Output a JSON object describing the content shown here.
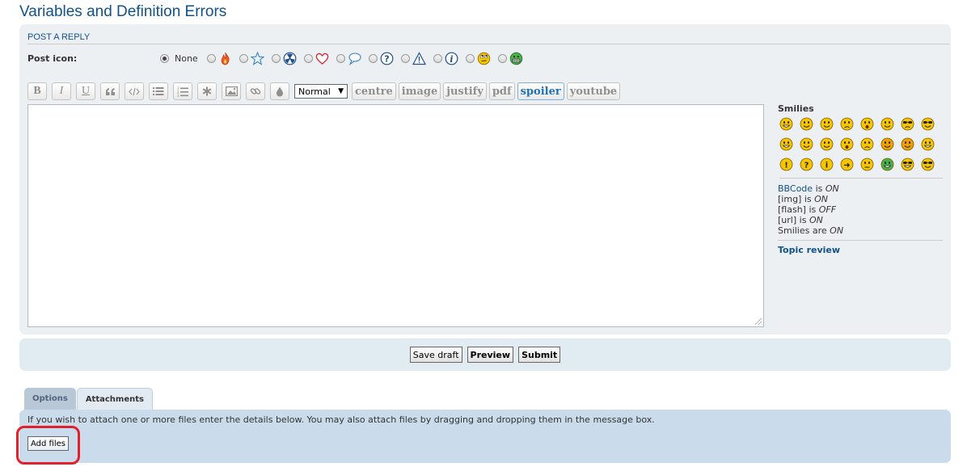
{
  "page": {
    "title": "Variables and Definition Errors"
  },
  "reply": {
    "heading": "POST A REPLY",
    "post_icon_label": "Post icon:",
    "none_label": "None",
    "icons": [
      "fire-icon",
      "star-icon",
      "radioactive-icon",
      "heart-icon",
      "speech-bubble-icon",
      "question-icon",
      "warning-icon",
      "info-icon",
      "rolling-eyes-icon",
      "grin-icon"
    ]
  },
  "toolbar": {
    "bold": "B",
    "italic": "I",
    "underline": "U",
    "font_size_value": "Normal",
    "words": [
      "centre",
      "image",
      "justify",
      "pdf",
      "spoiler",
      "youtube"
    ],
    "active_word": "spoiler"
  },
  "side": {
    "smilies_title": "Smilies",
    "bbcode_prefix": "BBCode",
    "bbcode_state": "ON",
    "img_label": "[img]",
    "img_state": "ON",
    "flash_label": "[flash]",
    "flash_state": "OFF",
    "url_label": "[url]",
    "url_state": "ON",
    "smilies_label": "Smilies are",
    "smilies_state": "ON",
    "is_word": "is",
    "topic_review": "Topic review"
  },
  "submit": {
    "save_draft": "Save draft",
    "preview": "Preview",
    "submit": "Submit"
  },
  "tabs": {
    "options": "Options",
    "attachments": "Attachments"
  },
  "attachments": {
    "instructions": "If you wish to attach one or more files enter the details below. You may also attach files by dragging and dropping them in the message box.",
    "add_files": "Add files"
  },
  "colors": {
    "link": "#105289",
    "highlight": "#e0202a",
    "smiley": "#f7c500"
  }
}
